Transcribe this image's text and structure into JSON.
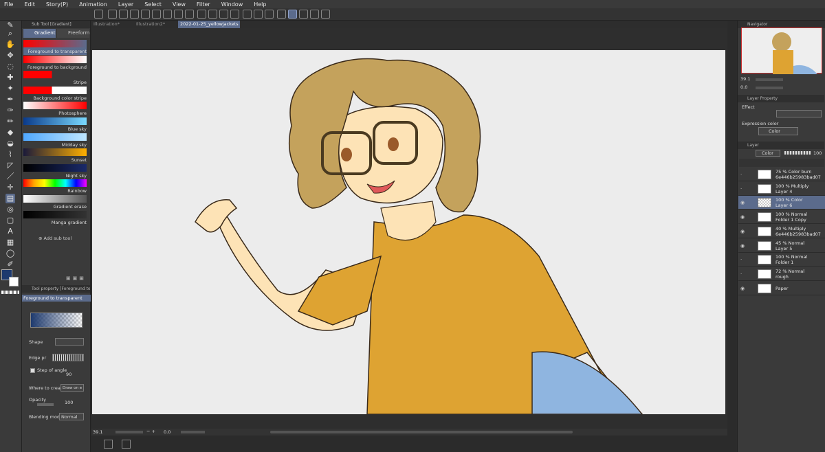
{
  "menu": [
    "File",
    "Edit",
    "Story(P)",
    "Animation",
    "Layer",
    "Select",
    "View",
    "Filter",
    "Window",
    "Help"
  ],
  "sub_tool": {
    "panel_title": "Sub Tool [Gradient]",
    "tabs": [
      "Gradient",
      "Freeform"
    ],
    "gradients": [
      {
        "label": "Foreground to transparent",
        "colors": [
          "#ff0000",
          "#ff000000"
        ]
      },
      {
        "label": "Foreground to background",
        "colors": [
          "#ff0000",
          "#ffffff"
        ]
      },
      {
        "label": "Stripe",
        "colors": [
          "#ff0000",
          "#ff0000"
        ]
      },
      {
        "label": "Background color stripe",
        "colors": [
          "#ff0000",
          "#ffffff"
        ]
      },
      {
        "label": "Photosphere",
        "colors": [
          "#ffffff",
          "#ff0000"
        ]
      },
      {
        "label": "Blue sky",
        "colors": [
          "#0a3a8a",
          "#7ad9ff"
        ]
      },
      {
        "label": "Midday sky",
        "colors": [
          "#4fa8ff",
          "#bfe6ff"
        ]
      },
      {
        "label": "Sunset",
        "colors": [
          "#1a1a3a",
          "#ffb000"
        ]
      },
      {
        "label": "Night sky",
        "colors": [
          "#000000",
          "#1a2a6a"
        ]
      },
      {
        "label": "Rainbow",
        "colors": [
          "#ff0000",
          "#0000ff"
        ]
      },
      {
        "label": "Gradient erase",
        "colors": [
          "#ffffff",
          "#555555"
        ]
      },
      {
        "label": "Manga gradient",
        "colors": [
          "#000000",
          "#333333"
        ]
      }
    ],
    "add_label": "Add sub tool"
  },
  "tool_property": {
    "panel_title": "Tool property [Foreground to transparent]",
    "selected": "Foreground to transparent",
    "shape_label": "Shape",
    "edge_label": "Edge pr",
    "step_label": "Step of angle",
    "step_value": "90",
    "where_label": "Where to create",
    "where_value": "Draw on e",
    "opacity_label": "Opacity",
    "opacity_value": "100",
    "blend_label": "Blending mode",
    "blend_value": "Normal"
  },
  "doc_tabs": [
    "Illustration*",
    "Illustration2*",
    "2022-01-25_yellowjackets"
  ],
  "status": {
    "zoom": "39.1",
    "angle": "0.0"
  },
  "navigator": {
    "title": "Navigator",
    "zoom": "39.1",
    "angle": "0.0"
  },
  "layer_property": {
    "title": "Layer Property",
    "effect_label": "Effect",
    "expression_label": "Expression color",
    "expression_value": "Color"
  },
  "layer_panel": {
    "title": "Layer",
    "blend": "Color",
    "opacity": "100",
    "layers": [
      {
        "line1": "75 % Color burn",
        "line2": "6e446b25983bad07",
        "visible": false,
        "selected": false
      },
      {
        "line1": "100 % Multiply",
        "line2": "Layer 4",
        "visible": false,
        "selected": false
      },
      {
        "line1": "100 % Color",
        "line2": "Layer 6",
        "visible": true,
        "selected": true
      },
      {
        "line1": "100 % Normal",
        "line2": "Folder 1 Copy",
        "visible": true,
        "selected": false
      },
      {
        "line1": "40 % Multiply",
        "line2": "6e446b25983bad07",
        "visible": true,
        "selected": false
      },
      {
        "line1": "45 % Normal",
        "line2": "Layer 5",
        "visible": true,
        "selected": false
      },
      {
        "line1": "100 % Normal",
        "line2": "Folder 1",
        "visible": false,
        "selected": false
      },
      {
        "line1": "72 % Normal",
        "line2": "rough",
        "visible": false,
        "selected": false
      },
      {
        "line1": "Paper",
        "line2": "",
        "visible": true,
        "selected": false
      }
    ]
  },
  "colors": {
    "accent": "#5b6b8c",
    "main_color": "#1e3a6e",
    "sub_color": "#ffffff"
  }
}
